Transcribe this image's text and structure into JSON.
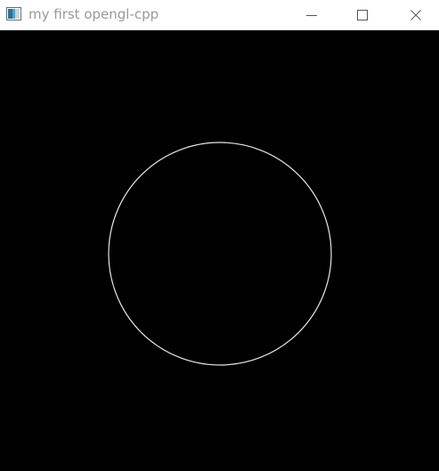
{
  "window": {
    "title": "my first opengl-cpp",
    "icon": "opengl-app-icon",
    "controls": {
      "minimize_icon": "minimize-icon",
      "maximize_icon": "maximize-icon",
      "close_icon": "close-icon"
    }
  },
  "render": {
    "background_color": "#000000",
    "shape": "circle",
    "shape_color": "#e6e6e6"
  },
  "colors": {
    "titlebar_bg": "#ffffff",
    "title_text": "#9a9a9a",
    "control_glyph": "#555555"
  }
}
